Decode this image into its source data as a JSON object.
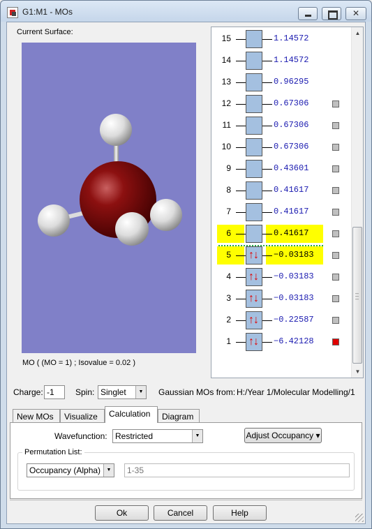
{
  "window": {
    "title": "G1:M1 - MOs"
  },
  "surface": {
    "label": "Current Surface:",
    "caption": "MO ( (MO = 1) ; Isovalue = 0.02 )"
  },
  "mo_list": [
    {
      "num": "15",
      "energy": "1.14572",
      "occupancy": 0,
      "checkbox": false,
      "highlight": false,
      "checked": false
    },
    {
      "num": "14",
      "energy": "1.14572",
      "occupancy": 0,
      "checkbox": false,
      "highlight": false,
      "checked": false
    },
    {
      "num": "13",
      "energy": "0.96295",
      "occupancy": 0,
      "checkbox": false,
      "highlight": false,
      "checked": false
    },
    {
      "num": "12",
      "energy": "0.67306",
      "occupancy": 0,
      "checkbox": true,
      "highlight": false,
      "checked": false
    },
    {
      "num": "11",
      "energy": "0.67306",
      "occupancy": 0,
      "checkbox": true,
      "highlight": false,
      "checked": false
    },
    {
      "num": "10",
      "energy": "0.67306",
      "occupancy": 0,
      "checkbox": true,
      "highlight": false,
      "checked": false
    },
    {
      "num": "9",
      "energy": "0.43601",
      "occupancy": 0,
      "checkbox": true,
      "highlight": false,
      "checked": false
    },
    {
      "num": "8",
      "energy": "0.41617",
      "occupancy": 0,
      "checkbox": true,
      "highlight": false,
      "checked": false
    },
    {
      "num": "7",
      "energy": "0.41617",
      "occupancy": 0,
      "checkbox": true,
      "highlight": false,
      "checked": false
    },
    {
      "num": "6",
      "energy": "0.41617",
      "occupancy": 0,
      "checkbox": true,
      "highlight": true,
      "checked": false
    },
    {
      "num": "5",
      "energy": "−0.03183",
      "occupancy": 2,
      "checkbox": true,
      "highlight": true,
      "checked": false
    },
    {
      "num": "4",
      "energy": "−0.03183",
      "occupancy": 2,
      "checkbox": true,
      "highlight": false,
      "checked": false
    },
    {
      "num": "3",
      "energy": "−0.03183",
      "occupancy": 2,
      "checkbox": true,
      "highlight": false,
      "checked": false
    },
    {
      "num": "2",
      "energy": "−0.22587",
      "occupancy": 2,
      "checkbox": true,
      "highlight": false,
      "checked": false
    },
    {
      "num": "1",
      "energy": "−6.42128",
      "occupancy": 2,
      "checkbox": true,
      "highlight": false,
      "checked": true
    }
  ],
  "settings": {
    "charge_label": "Charge:",
    "charge_value": "-1",
    "spin_label": "Spin:",
    "spin_value": "Singlet",
    "source_label": "Gaussian MOs from:",
    "source_path": "H:/Year 1/Molecular Modelling/1"
  },
  "tabs": [
    "New MOs",
    "Visualize",
    "Calculation",
    "Diagram"
  ],
  "calculation": {
    "wavefunction_label": "Wavefunction:",
    "wavefunction_value": "Restricted",
    "adjust_button": "Adjust Occupancy",
    "permutation_label": "Permutation List:",
    "occupancy_value": "Occupancy (Alpha)",
    "range_placeholder": "1-35"
  },
  "buttons": {
    "ok": "Ok",
    "cancel": "Cancel",
    "help": "Help"
  },
  "colors": {
    "viewport": "#8080c8",
    "highlight": "#ffff00",
    "orbital_box": "#a4c0e0",
    "electron_arrow": "#e00000",
    "energy_text": "#1a1ab0"
  }
}
